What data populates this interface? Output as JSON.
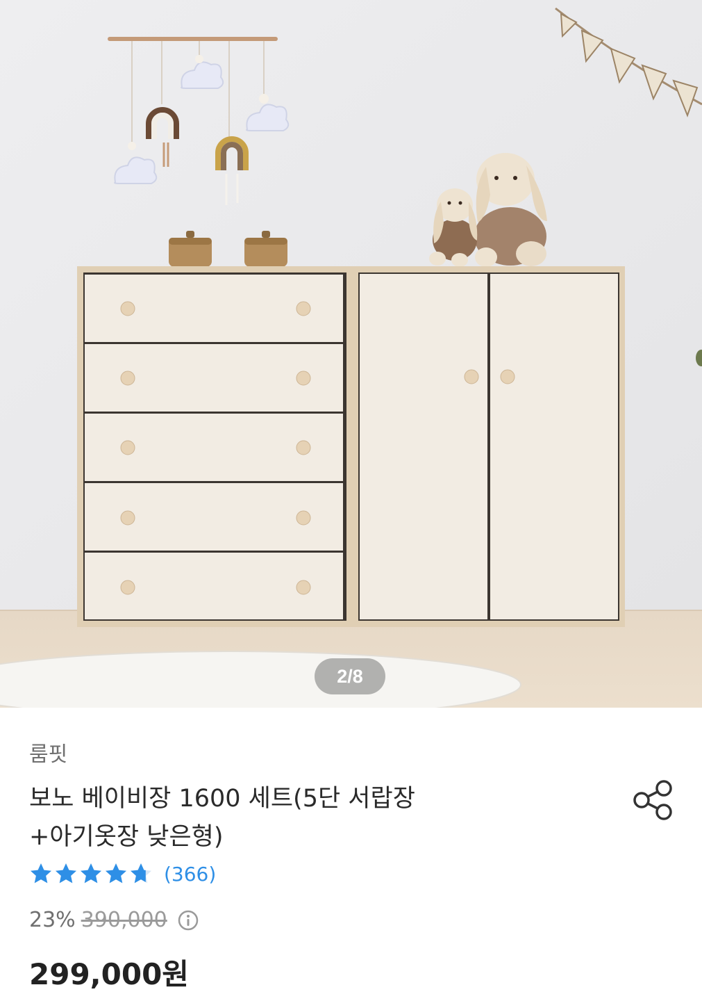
{
  "gallery": {
    "pager_label": "2/8",
    "current": 2,
    "total": 8
  },
  "product": {
    "brand": "룸핏",
    "title": "보노 베이비장 1600 세트(5단 서랍장 +아기옷장 낮은형)",
    "rating": 4.7,
    "rating_max": 5,
    "review_count_label": "(366)",
    "discount_rate": "23%",
    "original_price": "390,000",
    "sale_price": "299,000원"
  },
  "icons": {
    "share": "share-icon",
    "info": "info-icon",
    "star": "star-icon"
  },
  "colors": {
    "star": "#2e8fe6",
    "review_count": "#2e8fe6",
    "price": "#222222",
    "muted": "#6f6f6f"
  }
}
